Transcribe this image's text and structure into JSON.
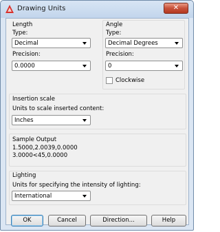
{
  "window": {
    "title": "Drawing Units",
    "close_icon": "close-icon"
  },
  "length": {
    "title": "Length",
    "type_label": "Type:",
    "type_value": "Decimal",
    "precision_label": "Precision:",
    "precision_value": "0.0000"
  },
  "angle": {
    "title": "Angle",
    "type_label": "Type:",
    "type_value": "Decimal Degrees",
    "precision_label": "Precision:",
    "precision_value": "0",
    "clockwise_label": "Clockwise",
    "clockwise_checked": false
  },
  "insertion": {
    "title": "Insertion scale",
    "desc": "Units to scale inserted content:",
    "value": "Inches"
  },
  "sample": {
    "title": "Sample Output",
    "line1": "1.5000,2.0039,0.0000",
    "line2": "3.0000<45,0.0000"
  },
  "lighting": {
    "title": "Lighting",
    "desc": "Units for specifying the intensity of lighting:",
    "value": "International"
  },
  "buttons": {
    "ok": "OK",
    "cancel": "Cancel",
    "direction": "Direction...",
    "help": "Help"
  },
  "colors": {
    "close": "#c7513a",
    "frame": "#dbe6f3",
    "face": "#f0f0f0"
  }
}
